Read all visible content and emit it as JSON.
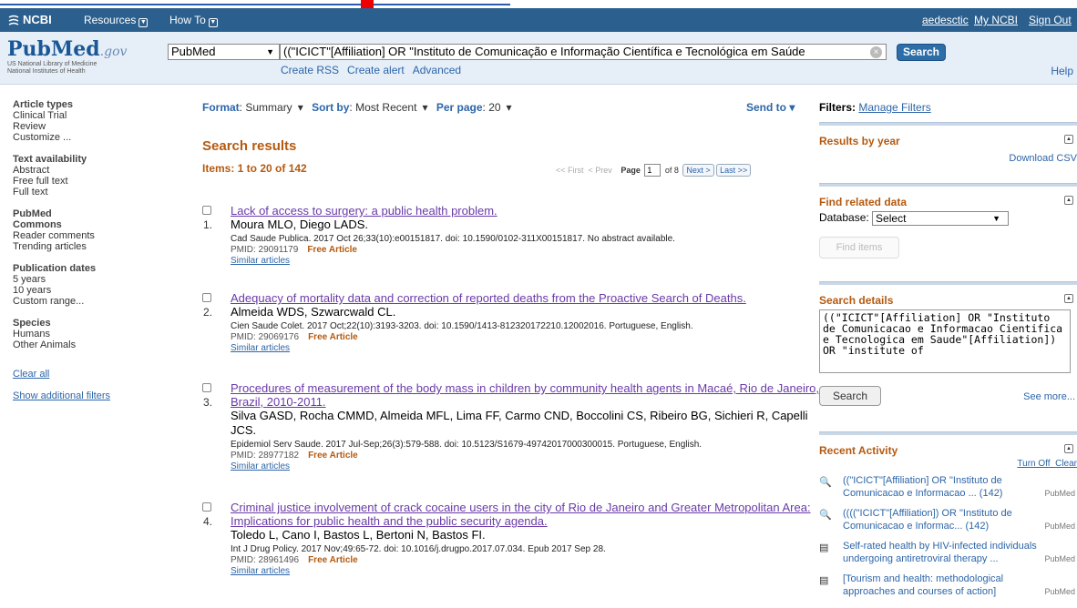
{
  "ncbi": {
    "logo": "NCBI",
    "resources": "Resources",
    "howto": "How To",
    "user": "aedesctic",
    "myncbi": "My NCBI",
    "signout": "Sign Out"
  },
  "brand": {
    "name1": "Pub",
    "name2": "Med",
    "gov": ".gov",
    "line1": "US National Library of Medicine",
    "line2": "National Institutes of Health"
  },
  "search": {
    "db": "PubMed",
    "query": "((\"ICICT\"[Affiliation] OR \"Instituto de Comunicação e Informação Científica e Tecnológica em Saúde",
    "button": "Search",
    "rss": "Create RSS",
    "alert": "Create alert",
    "advanced": "Advanced",
    "help": "Help"
  },
  "left": {
    "article_types": "Article types",
    "clinical": "Clinical Trial",
    "review": "Review",
    "customize": "Customize ...",
    "text_avail": "Text availability",
    "abstract": "Abstract",
    "free_full": "Free full text",
    "full_text": "Full text",
    "pubmed": "PubMed",
    "commons": "Commons",
    "reader": "Reader comments",
    "trending": "Trending articles",
    "pubdates": "Publication dates",
    "y5": "5 years",
    "y10": "10 years",
    "custom": "Custom range...",
    "species": "Species",
    "humans": "Humans",
    "other": "Other Animals",
    "clear": "Clear all",
    "show": "Show additional filters"
  },
  "toolbar": {
    "format_label": "Format",
    "format": "Summary",
    "sort_label": "Sort by",
    "sort": "Most Recent",
    "perpage_label": "Per page",
    "perpage": "20",
    "sendto": "Send to"
  },
  "results": {
    "heading": "Search results",
    "items": "Items: 1 to 20 of 142",
    "first": "<< First",
    "prev": "< Prev",
    "page_label": "Page",
    "page": "1",
    "of": "of 8",
    "next": "Next >",
    "last": "Last >>"
  },
  "list": [
    {
      "num": "1.",
      "title": "Lack of access to surgery: a public health problem.",
      "authors": "Moura MLO, Diego LADS.",
      "source": "Cad Saude Publica. 2017 Oct 26;33(10):e00151817. doi: 10.1590/0102-311X00151817. No abstract available.",
      "pmid": "PMID: 29091179",
      "free": "Free Article",
      "similar": "Similar articles"
    },
    {
      "num": "2.",
      "title": "Adequacy of mortality data and correction of reported deaths from the Proactive Search of Deaths.",
      "authors": "Almeida WDS, Szwarcwald CL.",
      "source": "Cien Saude Colet. 2017 Oct;22(10):3193-3203. doi: 10.1590/1413-812320172210.12002016. Portuguese, English.",
      "pmid": "PMID: 29069176",
      "free": "Free Article",
      "similar": "Similar articles"
    },
    {
      "num": "3.",
      "title": "Procedures of measurement of the body mass in children by community health agents in Macaé, Rio de Janeiro, Brazil, 2010-2011.",
      "authors": "Silva GASD, Rocha CMMD, Almeida MFL, Lima FF, Carmo CND, Boccolini CS, Ribeiro BG, Sichieri R, Capelli JCS.",
      "source": "Epidemiol Serv Saude. 2017 Jul-Sep;26(3):579-588. doi: 10.5123/S1679-49742017000300015. Portuguese, English.",
      "pmid": "PMID: 28977182",
      "free": "Free Article",
      "similar": "Similar articles"
    },
    {
      "num": "4.",
      "title": "Criminal justice involvement of crack cocaine users in the city of Rio de Janeiro and Greater Metropolitan Area: Implications for public health and the public security agenda.",
      "authors": "Toledo L, Cano I, Bastos L, Bertoni N, Bastos FI.",
      "source": "Int J Drug Policy. 2017 Nov;49:65-72. doi: 10.1016/j.drugpo.2017.07.034. Epub 2017 Sep 28.",
      "pmid": "PMID: 28961496",
      "free": "Free Article",
      "similar": "Similar articles"
    }
  ],
  "right": {
    "filters": "Filters:",
    "manage": "Manage Filters",
    "by_year": "Results by year",
    "download": "Download CSV",
    "related": "Find related data",
    "database": "Database:",
    "select": "Select",
    "find": "Find items",
    "details": "Search details",
    "details_text": "((\"ICICT\"[Affiliation] OR \"Instituto de Comunicacao e Informacao Cientifica e Tecnologica em Saude\"[Affiliation]) OR \"institute of",
    "search": "Search",
    "seemore": "See more...",
    "recent": "Recent Activity",
    "turnoff": "Turn Off",
    "clear": "Clear",
    "activity": [
      {
        "text": "((\"ICICT\"[Affiliation] OR \"Instituto de Comunicacao e Informacao ... (142)",
        "db": "PubMed"
      },
      {
        "text": "((((\"ICICT\"[Affiliation]) OR \"Instituto de Comunicacao e Informac... (142)",
        "db": "PubMed"
      },
      {
        "text": "Self-rated health by HIV-infected individuals undergoing antiretroviral therapy ...",
        "db": "PubMed"
      },
      {
        "text": "[Tourism and health: methodological approaches and courses of action]",
        "db": "PubMed"
      }
    ]
  }
}
